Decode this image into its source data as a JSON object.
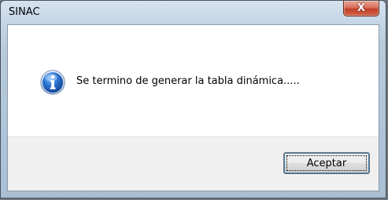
{
  "window": {
    "title": "SINAC",
    "close_symbol": "X"
  },
  "dialog": {
    "icon": "information-icon",
    "message": "Se termino de generar la tabla dinámica.....",
    "ok_label": "Aceptar"
  },
  "colors": {
    "icon_blue": "#1f5fb8",
    "close_red": "#c2402a"
  }
}
